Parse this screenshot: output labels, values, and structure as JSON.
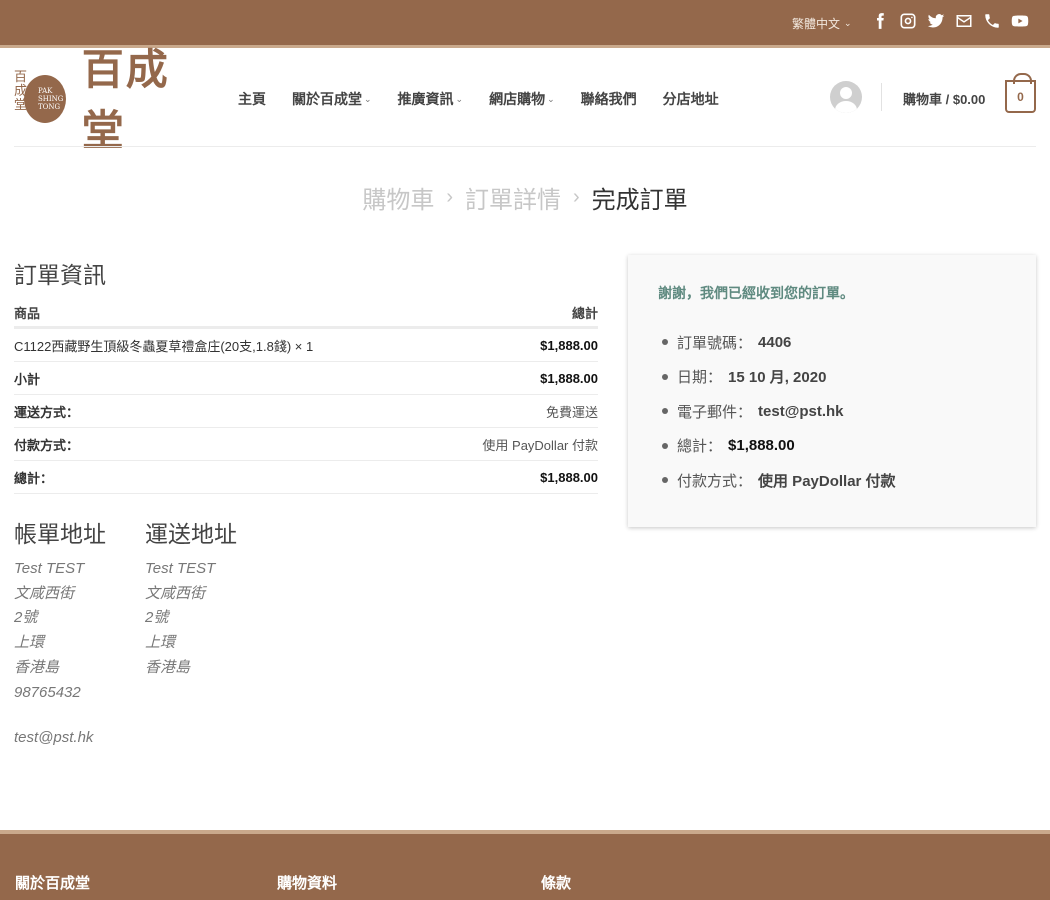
{
  "topbar": {
    "language": "繁體中文",
    "social_icons": [
      "facebook-icon",
      "instagram-icon",
      "twitter-icon",
      "envelope-icon",
      "phone-icon",
      "youtube-icon"
    ]
  },
  "brand": {
    "name": "百成堂",
    "mark_chars": "百成堂",
    "mark_latin": "PAK SHING TONG"
  },
  "nav": {
    "items": [
      {
        "label": "主頁",
        "dropdown": false
      },
      {
        "label": "關於百成堂",
        "dropdown": true
      },
      {
        "label": "推廣資訊",
        "dropdown": true
      },
      {
        "label": "網店購物",
        "dropdown": true
      },
      {
        "label": "聯絡我們",
        "dropdown": false
      },
      {
        "label": "分店地址",
        "dropdown": false
      }
    ]
  },
  "cart": {
    "label": "購物車 / $0.00",
    "count": "0"
  },
  "breadcrumb": {
    "step1": "購物車",
    "step2": "訂單詳情",
    "step3": "完成訂單",
    "separator": "›"
  },
  "order": {
    "title": "訂單資訊",
    "col_product": "商品",
    "col_total": "總計",
    "item_name": "C1122西藏野生頂級冬蟲夏草禮盒庄(20支,1.8錢) × 1",
    "item_total": "$1,888.00",
    "subtotal_label": "小計",
    "subtotal_value": "$1,888.00",
    "shipping_label": "運送方式：",
    "shipping_value": "免費運送",
    "payment_label": "付款方式：",
    "payment_value": "使用 PayDollar 付款",
    "total_label": "總計：",
    "total_value": "$1,888.00"
  },
  "billing": {
    "title": "帳單地址",
    "lines": [
      "Test TEST",
      "文咸西街",
      "2號",
      "上環",
      "香港島",
      "98765432"
    ],
    "email": "test@pst.hk"
  },
  "shipping": {
    "title": "運送地址",
    "lines": [
      "Test TEST",
      "文咸西街",
      "2號",
      "上環",
      "香港島"
    ]
  },
  "summary": {
    "thanks": "謝謝，我們已經收到您的訂單。",
    "order_no_label": "訂單號碼：",
    "order_no": "4406",
    "date_label": "日期：",
    "date": "15 10 月, 2020",
    "email_label": "電子郵件：",
    "email": "test@pst.hk",
    "total_label": "總計：",
    "total": "$1,888.00",
    "payment_label": "付款方式：",
    "payment": "使用 PayDollar 付款"
  },
  "footer": {
    "col1": "關於百成堂",
    "col2": "購物資料",
    "col3": "條款"
  }
}
